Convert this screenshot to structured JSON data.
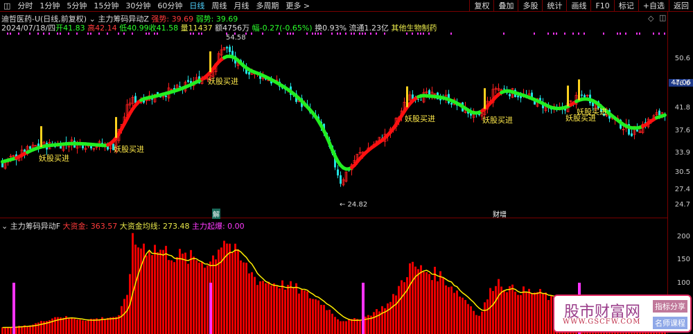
{
  "toolbar": {
    "tabs": [
      "分时",
      "1分钟",
      "5分钟",
      "15分钟",
      "30分钟",
      "60分钟",
      "日线",
      "周线",
      "月线",
      "多周期",
      "更多 >"
    ],
    "active": 6,
    "right": [
      "复权",
      "叠加",
      "多股",
      "统计",
      "画线",
      "F10",
      "标记",
      "+自选",
      "返回"
    ]
  },
  "header": {
    "title": "迪哲医药-U(日线,前复权)",
    "indicator": "主力筹码异动Z",
    "strong_label": "强势: 39.69",
    "weak_label": "弱势: 39.69"
  },
  "quote": {
    "date": "2024/07/18/四",
    "open": "开41.83",
    "high": "高42.14",
    "low": "低40.99",
    "close": "收41.58",
    "vol": "量11437",
    "amount": "额4756万",
    "change": "幅-0.27(-0.65%)",
    "turnover": "换0.93%",
    "float": "流通1.23亿",
    "sector": "其他生物制药"
  },
  "price_axis": [
    "50.6",
    "46.0",
    "41.8",
    "37.6",
    "33.9",
    "30.5",
    "27.4",
    "24.7"
  ],
  "current_price": "47.06",
  "high_label": "54.58",
  "low_label": "← 24.82",
  "signal_label": "妖股买进",
  "annotations": {
    "jie": "解",
    "cai": "财增"
  },
  "lower": {
    "title": "主力筹码异动F",
    "big_fund": "大资金: 363.57",
    "avg": "大资金均线: 273.48",
    "start": "主力起爆: 0.00",
    "axis": [
      "200",
      "150",
      "100"
    ]
  },
  "logo": {
    "name": "股市财富网",
    "url": "WWW.GSCFW.COM",
    "badge1": "指标分享",
    "badge2": "名师课程"
  },
  "colors": {
    "up": "#ff2020",
    "down": "#20e0e0",
    "ma_up": "#ff1010",
    "ma_down": "#22ee22",
    "bar": "#ee0000",
    "avg": "#ffee00",
    "spike": "#ff33ff"
  },
  "chart_data": {
    "type": "candlestick",
    "days": 240,
    "price_anchors": [
      [
        0,
        32.0
      ],
      [
        12,
        35.1
      ],
      [
        25,
        35.7
      ],
      [
        40,
        35.1
      ],
      [
        46,
        43.1
      ],
      [
        57,
        44.3
      ],
      [
        65,
        45.5
      ],
      [
        75,
        48.0
      ],
      [
        80,
        53.0
      ],
      [
        85,
        49.2
      ],
      [
        95,
        47.3
      ],
      [
        105,
        44.3
      ],
      [
        115,
        38.8
      ],
      [
        122,
        28.9
      ],
      [
        128,
        33.4
      ],
      [
        140,
        37.6
      ],
      [
        147,
        44.3
      ],
      [
        160,
        43.7
      ],
      [
        172,
        40.0
      ],
      [
        178,
        45.5
      ],
      [
        190,
        43.7
      ],
      [
        200,
        41.2
      ],
      [
        210,
        44.3
      ],
      [
        220,
        40.0
      ],
      [
        227,
        37.6
      ],
      [
        238,
        41.2
      ]
    ],
    "fund_anchors": [
      [
        0,
        5
      ],
      [
        10,
        10
      ],
      [
        20,
        30
      ],
      [
        30,
        22
      ],
      [
        42,
        30
      ],
      [
        45,
        80
      ],
      [
        47,
        190
      ],
      [
        55,
        180
      ],
      [
        65,
        160
      ],
      [
        75,
        150
      ],
      [
        80,
        205
      ],
      [
        85,
        160
      ],
      [
        92,
        110
      ],
      [
        105,
        95
      ],
      [
        115,
        60
      ],
      [
        122,
        20
      ],
      [
        130,
        25
      ],
      [
        140,
        60
      ],
      [
        147,
        140
      ],
      [
        158,
        120
      ],
      [
        168,
        60
      ],
      [
        172,
        30
      ],
      [
        178,
        110
      ],
      [
        183,
        90
      ],
      [
        195,
        80
      ],
      [
        205,
        40
      ],
      [
        215,
        30
      ],
      [
        239,
        20
      ]
    ],
    "signal_days": [
      14,
      41,
      75,
      146,
      174,
      204,
      208
    ],
    "spike_days": [
      4,
      75,
      130,
      208
    ]
  }
}
